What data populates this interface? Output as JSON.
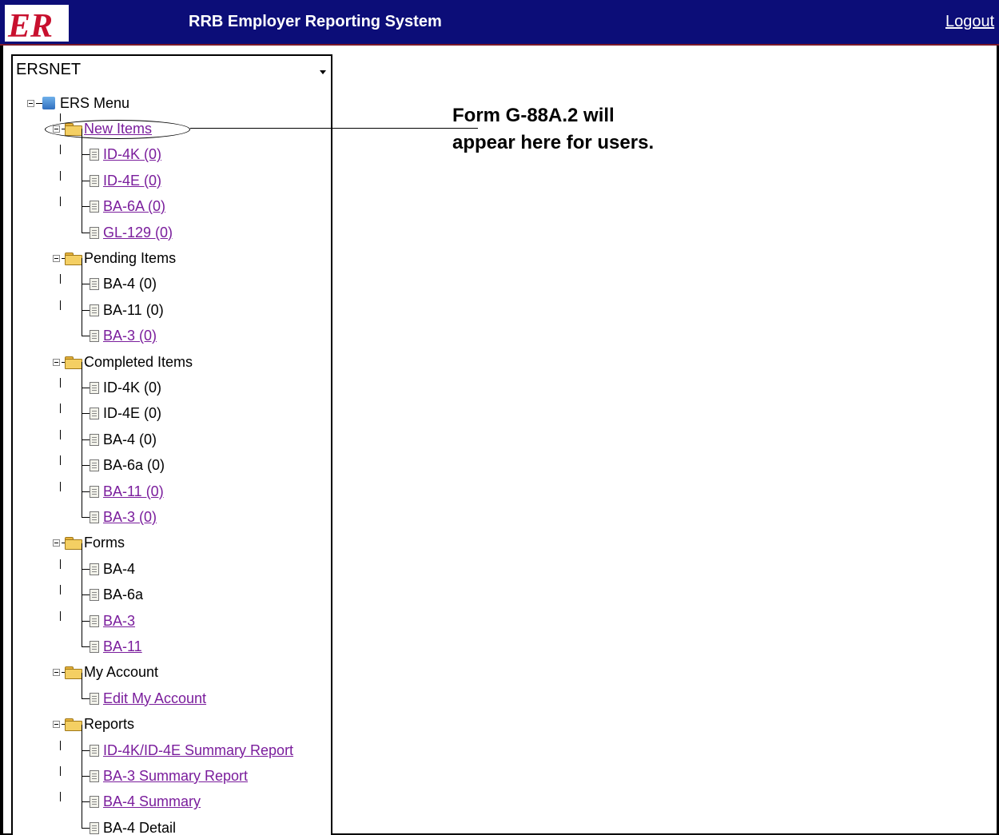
{
  "header": {
    "logo_text": "ER",
    "title": "RRB Employer Reporting System",
    "logout_label": "Logout"
  },
  "sidebar": {
    "selector_value": "ERSNET",
    "root_label": "ERS Menu",
    "folders": [
      {
        "label": "New Items",
        "link": true,
        "children": [
          {
            "label": "ID-4K (0)",
            "link": true
          },
          {
            "label": "ID-4E (0)",
            "link": true
          },
          {
            "label": "BA-6A (0)",
            "link": true
          },
          {
            "label": "GL-129 (0)",
            "link": true
          }
        ]
      },
      {
        "label": "Pending Items",
        "link": false,
        "children": [
          {
            "label": "BA-4 (0)",
            "link": false
          },
          {
            "label": "BA-11 (0)",
            "link": false
          },
          {
            "label": "BA-3 (0)",
            "link": true
          }
        ]
      },
      {
        "label": "Completed Items",
        "link": false,
        "children": [
          {
            "label": "ID-4K (0)",
            "link": false
          },
          {
            "label": "ID-4E (0)",
            "link": false
          },
          {
            "label": "BA-4 (0)",
            "link": false
          },
          {
            "label": "BA-6a (0)",
            "link": false
          },
          {
            "label": "BA-11 (0)",
            "link": true
          },
          {
            "label": "BA-3 (0)",
            "link": true
          }
        ]
      },
      {
        "label": "Forms",
        "link": false,
        "children": [
          {
            "label": "BA-4",
            "link": false
          },
          {
            "label": "BA-6a",
            "link": false
          },
          {
            "label": "BA-3",
            "link": true
          },
          {
            "label": "BA-11",
            "link": true
          }
        ]
      },
      {
        "label": "My Account",
        "link": false,
        "children": [
          {
            "label": "Edit My Account",
            "link": true
          }
        ]
      },
      {
        "label": "Reports",
        "link": false,
        "children": [
          {
            "label": "ID-4K/ID-4E Summary Report",
            "link": true
          },
          {
            "label": "BA-3 Summary Report",
            "link": true
          },
          {
            "label": "BA-4 Summary",
            "link": true
          },
          {
            "label": "BA-4 Detail",
            "link": false
          }
        ]
      }
    ]
  },
  "annotation": {
    "line1": "Form G-88A.2 will",
    "line2": "appear here for users."
  },
  "colors": {
    "header_bg": "#0c0d78",
    "link": "#7a1d9c",
    "logo_red": "#c8102e"
  }
}
